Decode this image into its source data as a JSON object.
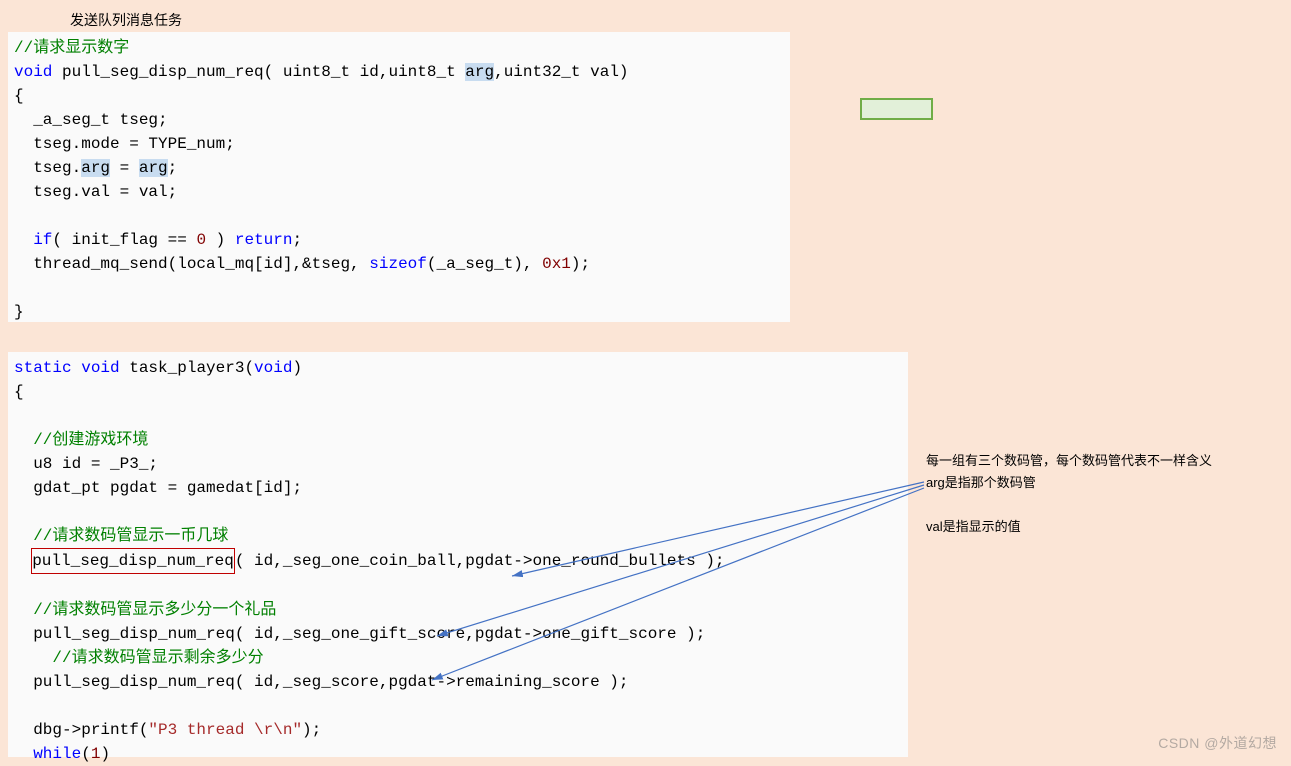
{
  "title": "发送队列消息任务",
  "block1": {
    "line1": "//请求显示数字",
    "line2_a": "void",
    "line2_b": " pull_seg_disp_num_req( uint8_t id,uint8_t ",
    "line2_c": "arg",
    "line2_d": ",uint32_t val)",
    "line3": "{",
    "line4": "  _a_seg_t tseg;",
    "line5": "  tseg.mode = TYPE_num;",
    "line6_a": "  tseg.",
    "line6_b": "arg",
    "line6_c": " = ",
    "line6_d": "arg",
    "line6_e": ";",
    "line7": "  tseg.val = val;",
    "line8": "",
    "line9_a": "  if",
    "line9_b": "( init_flag == ",
    "line9_c": "0",
    "line9_d": " ) ",
    "line9_e": "return",
    "line9_f": ";",
    "line10_a": "  thread_mq_send(local_mq[id],&tseg, ",
    "line10_b": "sizeof",
    "line10_c": "(_a_seg_t), ",
    "line10_d": "0x1",
    "line10_e": ");",
    "line11": "",
    "line12": "}"
  },
  "block2": {
    "l1_a": "static",
    "l1_b": " ",
    "l1_c": "void",
    "l1_d": " task_player3(",
    "l1_e": "void",
    "l1_f": ")",
    "l2": "{",
    "l3": "",
    "l4": "  //创建游戏环境",
    "l5": "  u8 id = _P3_;",
    "l6": "  gdat_pt pgdat = gamedat[id];",
    "l7": "",
    "l8": "  //请求数码管显示一币几球",
    "l9_a": "pull_seg_disp_num_req",
    "l9_b": "( id,_seg_one_coin_ball,pgdat->one_round_bullets );",
    "l10": "",
    "l11": "  //请求数码管显示多少分一个礼品",
    "l12": "  pull_seg_disp_num_req( id,_seg_one_gift_score,pgdat->one_gift_score );",
    "l13": "    //请求数码管显示剩余多少分",
    "l14": "  pull_seg_disp_num_req( id,_seg_score,pgdat->remaining_score );",
    "l15": "",
    "l16_a": "  dbg->printf(",
    "l16_b": "\"P3 thread \\r\\n\"",
    "l16_c": ");",
    "l17_a": "  while",
    "l17_b": "(",
    "l17_c": "1",
    "l17_d": ")"
  },
  "notes": {
    "n1": "每一组有三个数码管，每个数码管代表不一样含义",
    "n2": "arg是指那个数码管",
    "n3": "val是指显示的值"
  },
  "watermark": "CSDN @外道幻想"
}
